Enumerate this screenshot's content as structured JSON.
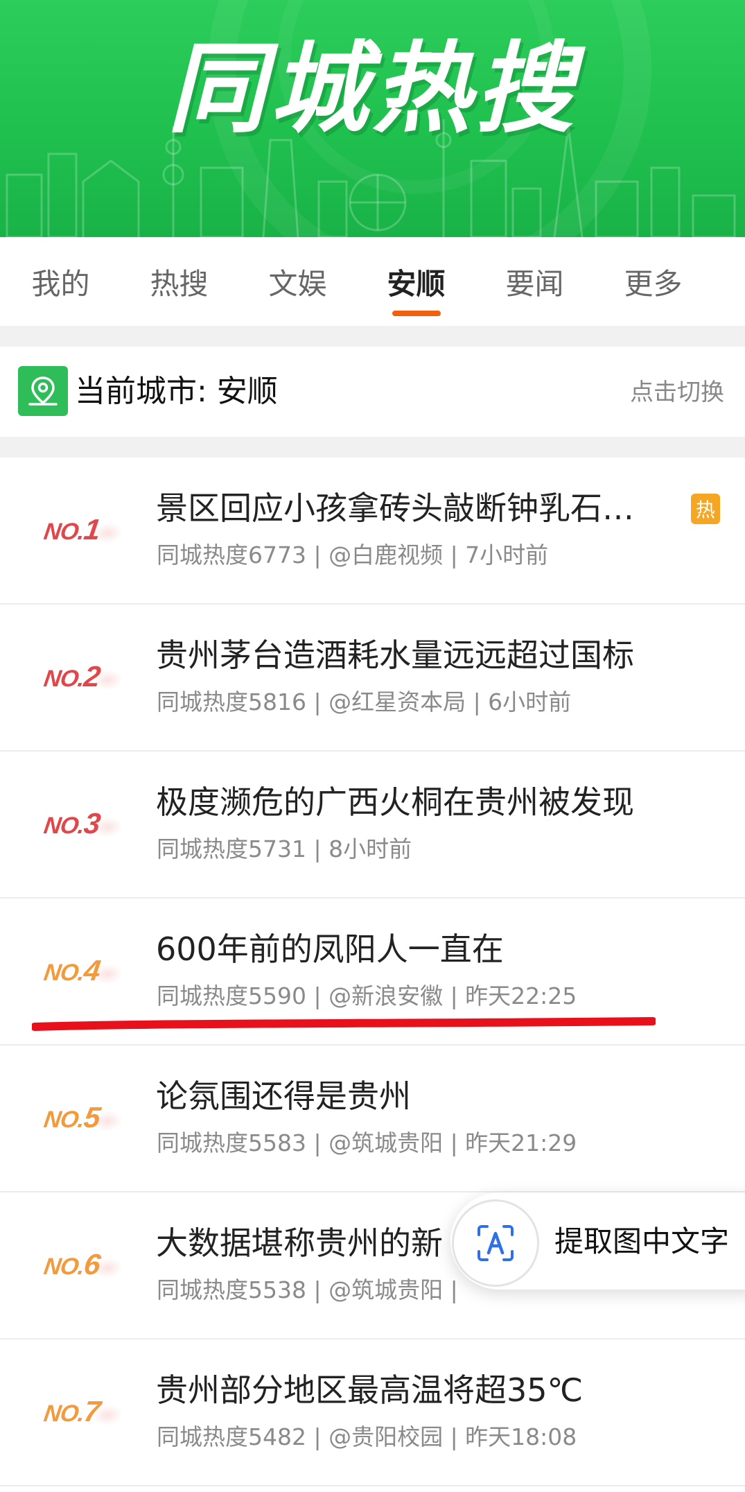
{
  "banner": {
    "title": "同城热搜"
  },
  "tabs": [
    {
      "label": "我的"
    },
    {
      "label": "热搜"
    },
    {
      "label": "文娱"
    },
    {
      "label": "安顺",
      "active": true
    },
    {
      "label": "要闻"
    },
    {
      "label": "更多"
    }
  ],
  "city": {
    "label": "当前城市: 安顺",
    "switch_label": "点击切换",
    "icon": "location-icon"
  },
  "list": [
    {
      "no": "NO.",
      "rank": "1",
      "title": "景区回应小孩拿砖头敲断钟乳石…",
      "meta": "同城热度6773 | @白鹿视频 | 7小时前",
      "badge": "热"
    },
    {
      "no": "NO.",
      "rank": "2",
      "title": "贵州茅台造酒耗水量远远超过国标",
      "meta": "同城热度5816 | @红星资本局 | 6小时前"
    },
    {
      "no": "NO.",
      "rank": "3",
      "title": "极度濒危的广西火桐在贵州被发现",
      "meta": "同城热度5731 | 8小时前"
    },
    {
      "no": "NO.",
      "rank": "4",
      "title": "600年前的凤阳人一直在",
      "meta": "同城热度5590 | @新浪安徽 | 昨天22:25"
    },
    {
      "no": "NO.",
      "rank": "5",
      "title": "论氛围还得是贵州",
      "meta": "同城热度5583 | @筑城贵阳 | 昨天21:29"
    },
    {
      "no": "NO.",
      "rank": "6",
      "title": "大数据堪称贵州的新",
      "meta": "同城热度5538 | @筑城贵阳 |"
    },
    {
      "no": "NO.",
      "rank": "7",
      "title": "贵州部分地区最高温将超35℃",
      "meta": "同城热度5482 | @贵阳校园 | 昨天18:08"
    }
  ],
  "extract": {
    "label": "提取图中文字",
    "icon": "text-recognition-icon"
  },
  "colors": {
    "brand_green": "#22c553",
    "accent_orange": "#f1600f",
    "rank_red": "#e0464a",
    "rank_orange": "#f29a3c",
    "hot_badge": "#f5a623",
    "annotation_red": "#e8101b"
  }
}
